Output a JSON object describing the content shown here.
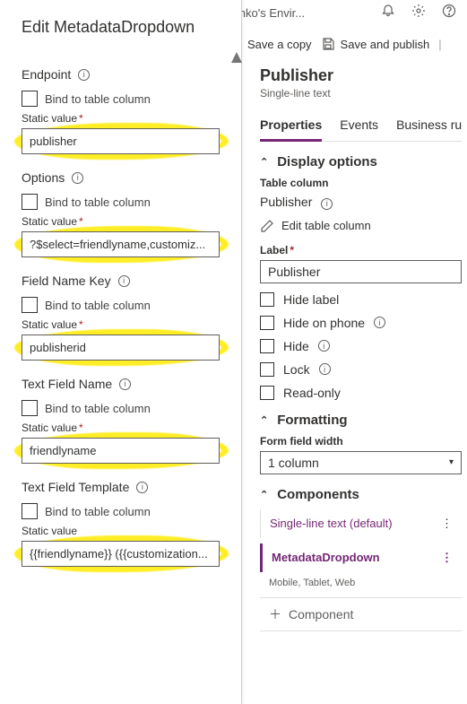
{
  "topbar": {
    "env": "Yurii Nazarenko's Envir..."
  },
  "cmd": {
    "savecopy": "Save a copy",
    "savepublish": "Save and publish"
  },
  "left": {
    "title": "Edit MetadataDropdown",
    "bind_label": "Bind to table column",
    "static": {
      "label": "Static value"
    },
    "endpoint": {
      "label": "Endpoint",
      "value": "publisher"
    },
    "options": {
      "label": "Options",
      "value": "?$select=friendlyname,customiz..."
    },
    "fieldnamekey": {
      "label": "Field Name Key",
      "value": "publisherid"
    },
    "textfieldname": {
      "label": "Text Field Name",
      "value": "friendlyname"
    },
    "textfieldtemplate": {
      "label": "Text Field Template",
      "value": "{{friendlyname}} ({{customization..."
    }
  },
  "right": {
    "title": "Publisher",
    "subtitle": "Single-line text",
    "tabs": {
      "properties": "Properties",
      "events": "Events",
      "business": "Business rul"
    },
    "display": {
      "header": "Display options",
      "tablecol_label": "Table column",
      "tablecol_value": "Publisher",
      "edit_link": "Edit table column",
      "label_label": "Label",
      "label_value": "Publisher",
      "opts": {
        "hidelabel": "Hide label",
        "hidephone": "Hide on phone",
        "hide": "Hide",
        "lock": "Lock",
        "readonly": "Read-only"
      }
    },
    "formatting": {
      "header": "Formatting",
      "width_label": "Form field width",
      "width_value": "1 column"
    },
    "components": {
      "header": "Components",
      "sl_default": "Single-line text (default)",
      "metadata": "MetadataDropdown",
      "clients": "Mobile, Tablet, Web",
      "add": "Component"
    }
  }
}
